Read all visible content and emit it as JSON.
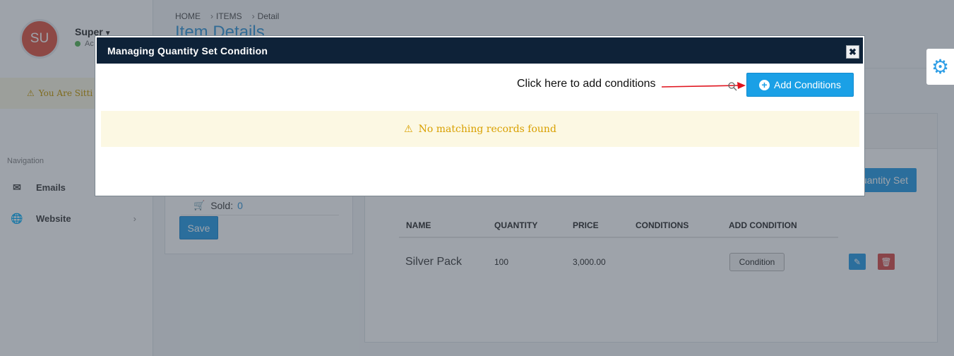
{
  "sidebar": {
    "avatar_initials": "SU",
    "user_name": "Super",
    "user_status": "Ac",
    "sitting_banner": "You Are Sitti",
    "nav_title": "Navigation",
    "items": [
      {
        "label": "Emails",
        "icon": "envelope-icon"
      },
      {
        "label": "Website",
        "icon": "globe-icon"
      }
    ]
  },
  "header": {
    "breadcrumb": [
      "HOME",
      "ITEMS",
      "Detail"
    ],
    "title": "Item Details"
  },
  "left_panel": {
    "sold_label": "Sold:",
    "sold_value": "0",
    "save_label": "Save"
  },
  "right_panel": {
    "quantity_set_button": "Quantity Set",
    "columns": [
      "NAME",
      "QUANTITY",
      "PRICE",
      "CONDITIONS",
      "ADD CONDITION"
    ],
    "rows": [
      {
        "name": "Silver Pack",
        "quantity": "100",
        "price": "3,000.00",
        "conditions": "",
        "add_condition": "Condition"
      }
    ]
  },
  "modal": {
    "title": "Managing Quantity Set Condition",
    "close_glyph": "✖",
    "hint": "Click here to add conditions",
    "add_button": "Add Conditions",
    "empty_message": "No matching records found"
  },
  "colors": {
    "accent": "#1aa0e6",
    "modal_header": "#0e2238",
    "warning_bg": "#fcf8e3",
    "warning_text": "#d9a000",
    "arrow": "#e0141e",
    "danger": "#d9534f"
  }
}
